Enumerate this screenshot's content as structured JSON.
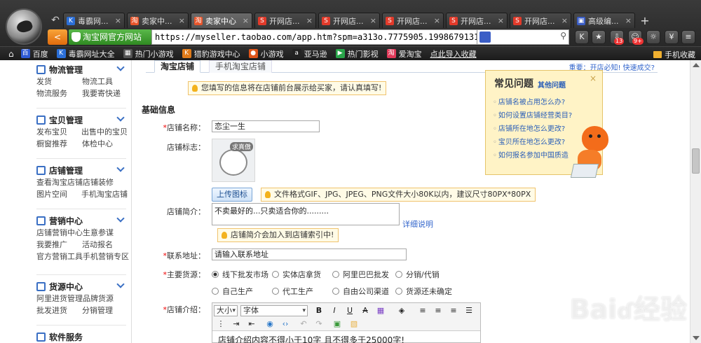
{
  "tabs": [
    {
      "label": "毒霸网...",
      "icon": "K",
      "color": "#2b6fd8"
    },
    {
      "label": "卖家中...",
      "icon": "淘",
      "color": "#e8552b"
    },
    {
      "label": "卖家中心",
      "icon": "淘",
      "color": "#e8552b"
    },
    {
      "label": "开网店...",
      "icon": "S",
      "color": "#e23a2a"
    },
    {
      "label": "开网店...",
      "icon": "S",
      "color": "#e23a2a"
    },
    {
      "label": "开网店...",
      "icon": "S",
      "color": "#e23a2a"
    },
    {
      "label": "开网店...",
      "icon": "S",
      "color": "#e23a2a"
    },
    {
      "label": "开网店...",
      "icon": "S",
      "color": "#e23a2a"
    },
    {
      "label": "高级编...",
      "icon": "▣",
      "color": "#3b5ec6"
    }
  ],
  "address": {
    "brand_label": "淘宝网官方网站",
    "url": "https://myseller.taobao.com/app.htm?spm=a313o.7775905.1998679131.c",
    "badge_download": "13",
    "badge_game": "9+"
  },
  "bookmarks": [
    {
      "label": "百度",
      "icon": "百",
      "color": "#2f5bd6"
    },
    {
      "label": "毒霸网址大全",
      "icon": "K",
      "color": "#2b6fd8"
    },
    {
      "label": "热门小游戏",
      "icon": "▦",
      "color": "#555"
    },
    {
      "label": "猎豹游戏中心",
      "icon": "K",
      "color": "#e07b1a"
    },
    {
      "label": "小游戏",
      "icon": "●",
      "color": "#e0551a"
    },
    {
      "label": "亚马逊",
      "icon": "a",
      "color": "#222"
    },
    {
      "label": "热门影视",
      "icon": "▶",
      "color": "#2aa54a"
    },
    {
      "label": "爱淘宝",
      "icon": "淘",
      "color": "#e23a5a"
    },
    {
      "label": "点此导入收藏",
      "icon": "",
      "color": ""
    }
  ],
  "bookmarks_right": "手机收藏",
  "sidebar": [
    {
      "title": "物流管理",
      "rows": [
        [
          "发货",
          "物流工具"
        ],
        [
          "物流服务",
          "我要寄快递"
        ]
      ]
    },
    {
      "title": "宝贝管理",
      "rows": [
        [
          "发布宝贝",
          "出售中的宝贝"
        ],
        [
          "橱窗推荐",
          "体检中心"
        ]
      ]
    },
    {
      "title": "店铺管理",
      "rows": [
        [
          "查看淘宝店铺",
          "店铺装修"
        ],
        [
          "图片空间",
          "手机淘宝店铺"
        ]
      ]
    },
    {
      "title": "营销中心",
      "rows": [
        [
          "店铺营销中心",
          "生意参谋"
        ],
        [
          "我要推广",
          "活动报名"
        ],
        [
          "官方营销工具",
          "手机营销专区"
        ]
      ]
    },
    {
      "title": "货源中心",
      "rows": [
        [
          "阿里进货管理",
          "品牌货源"
        ],
        [
          "批发进货",
          "分销管理"
        ]
      ]
    },
    {
      "title": "软件服务",
      "rows": []
    }
  ],
  "page_tabs": {
    "active": "淘宝店铺",
    "other": "手机淘宝店铺"
  },
  "notice_link": "重要：开店必知! 快速成交?",
  "tip_top": "您填写的信息将在店铺前台展示给买家，请认真填写!",
  "section_title": "基础信息",
  "form": {
    "shop_name_label": "店铺名称：",
    "shop_name_value": "恋尘一生",
    "logo_label": "店铺标志：",
    "avatar_bubble": "求真傲",
    "upload_button": "上传图标",
    "upload_tip": "文件格式GIF、JPG、JPEG、PNG文件大小80K以内，建议尺寸80PX*80PX",
    "intro_label": "店铺简介：",
    "intro_value": "不卖最好的...只卖适合你的.........",
    "intro_link": "详细说明",
    "intro_tip": "店铺简介会加入到店铺索引中!",
    "address_label": "联系地址：",
    "address_value": "请输入联系地址",
    "source_label": "主要货源：",
    "sources": [
      "线下批发市场",
      "实体店拿货",
      "阿里巴巴批发",
      "分销/代销",
      "自己生产",
      "代工生产",
      "自由公司渠道",
      "货源还未确定"
    ],
    "desc_label": "店铺介绍："
  },
  "editor": {
    "size_label": "大小",
    "font_label": "字体",
    "placeholder_text": "店铺介绍内容不得小于10字 且不得多于25000字!"
  },
  "faq": {
    "title": "常见问题",
    "other": "其他问题",
    "close": "×",
    "items": [
      "店铺名被占用怎么办?",
      "如何设置店铺经营类目?",
      "店铺所在地怎么更改?",
      "宝贝所在地怎么更改?",
      "如何报名参加中国质造"
    ]
  },
  "watermark": {
    "main": "Baiь经验",
    "sub": "jingyan.baidu.com"
  }
}
